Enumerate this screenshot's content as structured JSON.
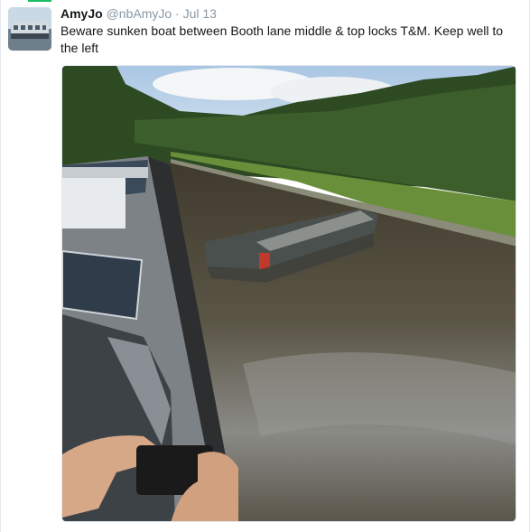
{
  "tweet": {
    "fullname": "AmyJo",
    "username": "@nbAmyJo",
    "separator": "·",
    "time": "Jul 13",
    "text": "Beware sunken boat between Booth lane middle & top locks T&M.  Keep well to the left"
  },
  "colors": {
    "name": "#14171a",
    "meta": "#8899a6",
    "accent_line": "#17bf63",
    "border": "#e1e8ed"
  },
  "icons": {
    "avatar": "narrowboat-avatar"
  }
}
